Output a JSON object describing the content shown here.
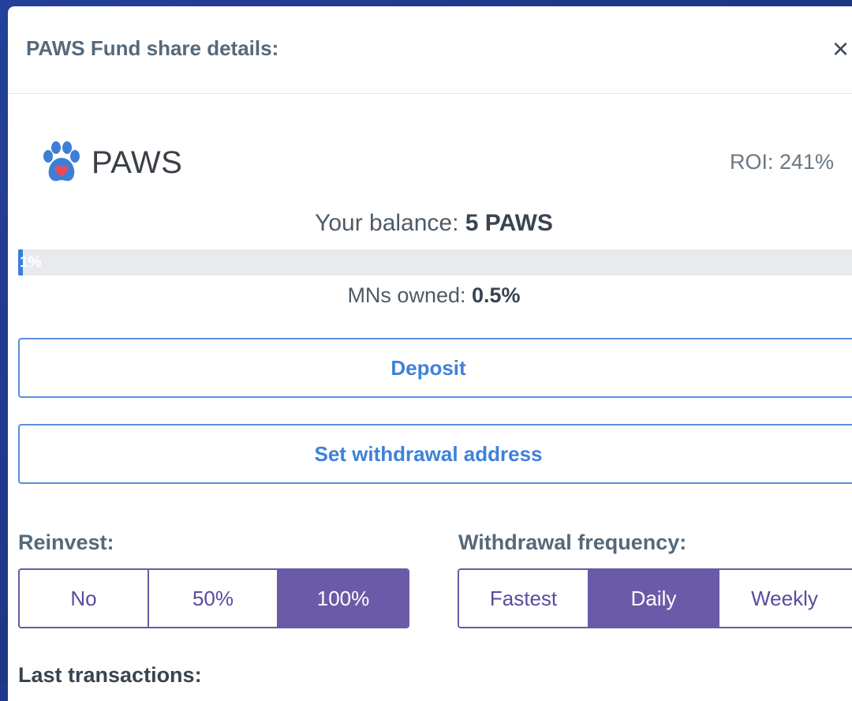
{
  "modal": {
    "title": "PAWS Fund share details:",
    "close_label": "×"
  },
  "fund": {
    "name": "PAWS",
    "logo_icon": "paw-heart-icon",
    "roi": "ROI: 241%"
  },
  "balance": {
    "prefix": "Your balance:",
    "value": "5 PAWS"
  },
  "progress": {
    "label": "1%",
    "value_percent": 1
  },
  "mns": {
    "prefix": "MNs owned:",
    "value": "0.5%"
  },
  "actions": {
    "deposit_label": "Deposit",
    "withdrawal_address_label": "Set withdrawal address"
  },
  "reinvest": {
    "label": "Reinvest:",
    "options": [
      "No",
      "50%",
      "100%"
    ],
    "selected": "100%"
  },
  "withdrawal_frequency": {
    "label": "Withdrawal frequency:",
    "options": [
      "Fastest",
      "Daily",
      "Weekly"
    ],
    "selected": "Daily"
  },
  "last_transactions": {
    "label": "Last transactions:"
  },
  "colors": {
    "accent_blue": "#3e82d8",
    "segment_purple": "#6b5aa8",
    "backdrop": "#1e3a8e"
  }
}
